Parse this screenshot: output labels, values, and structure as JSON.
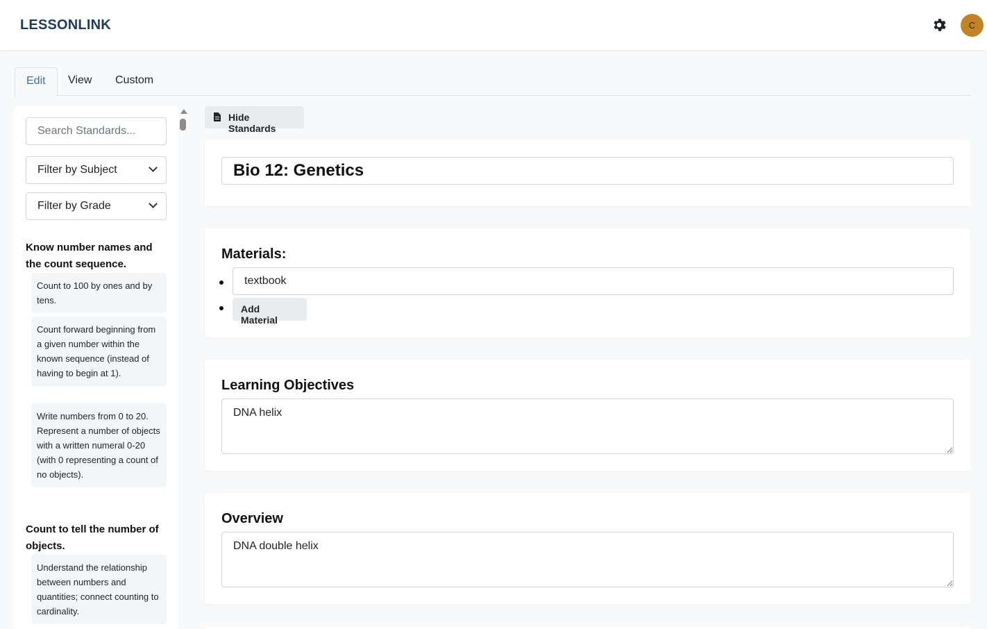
{
  "app": {
    "brand": "LESSONLINK",
    "avatar_initial": "C"
  },
  "tabs": [
    {
      "label": "Edit",
      "active": true
    },
    {
      "label": "View",
      "active": false
    },
    {
      "label": "Custom",
      "active": false
    }
  ],
  "sidebar": {
    "search_placeholder": "Search Standards...",
    "subject_filter": "Filter by Subject",
    "grade_filter": "Filter by Grade",
    "groups": [
      {
        "title": "Know number names and the count sequence.",
        "standards": [
          "Count to 100 by ones and by tens.",
          "Count forward beginning from a given number within the known sequence (instead of having to begin at 1).",
          "Write numbers from 0 to 20. Represent a number of objects with a written numeral 0-20 (with 0 representing a count of no objects)."
        ]
      },
      {
        "title": "Count to tell the number of objects.",
        "standards": [
          "Understand the relationship between numbers and quantities; connect counting to cardinality."
        ]
      }
    ]
  },
  "toolbar": {
    "hide_standards_label": "Hide Standards"
  },
  "lesson": {
    "title": "Bio 12: Genetics",
    "materials_heading": "Materials:",
    "materials": [
      "textbook"
    ],
    "add_material_label": "Add Material",
    "objectives_heading": "Learning Objectives",
    "objectives": "DNA helix",
    "overview_heading": "Overview",
    "overview": "DNA double helix"
  },
  "colors": {
    "brand": "#1e3a5f",
    "avatar": "#c08427",
    "active_tab": "#3f6f99"
  }
}
